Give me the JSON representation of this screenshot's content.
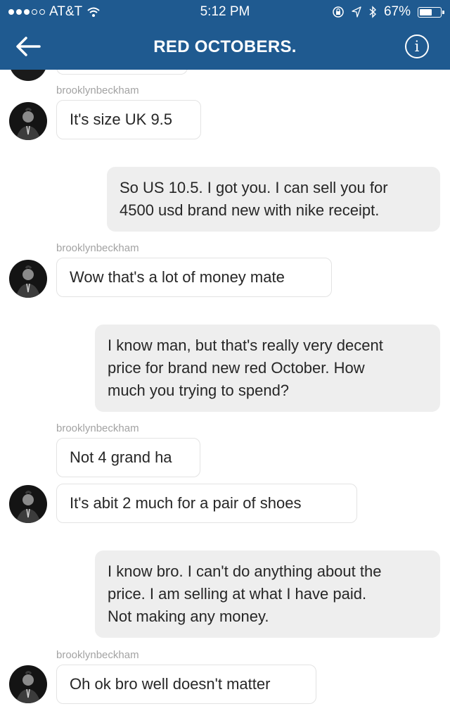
{
  "status_bar": {
    "carrier": "AT&T",
    "time": "5:12 PM",
    "battery": "67%",
    "battery_level": 0.67
  },
  "nav": {
    "title": "RED OCTOBERS.",
    "back_icon": "arrow-left-icon",
    "info_icon": "info-icon",
    "accent": "#1f5a90"
  },
  "messages": [
    {
      "sender": "brooklynbeckham",
      "text": "It's size UK 9.5"
    },
    {
      "text_lines": [
        "So US 10.5. I got you. I can sell you for",
        "4500 usd brand new with nike receipt."
      ]
    },
    {
      "sender": "brooklynbeckham",
      "text": "Wow that's a lot of money mate"
    },
    {
      "text_lines": [
        "I know man, but that's really very decent",
        "price for brand new red October. How",
        "much you trying to spend?"
      ]
    },
    {
      "sender": "brooklynbeckham",
      "text": "Not 4 grand ha"
    },
    {
      "text": "It's  abit 2 much for a pair of shoes"
    },
    {
      "text_lines": [
        "I know bro. I can't do anything about the",
        "price. I am selling at what I have paid.",
        "Not making any money."
      ]
    },
    {
      "sender": "brooklynbeckham",
      "text": "Oh ok bro well doesn't matter"
    }
  ]
}
